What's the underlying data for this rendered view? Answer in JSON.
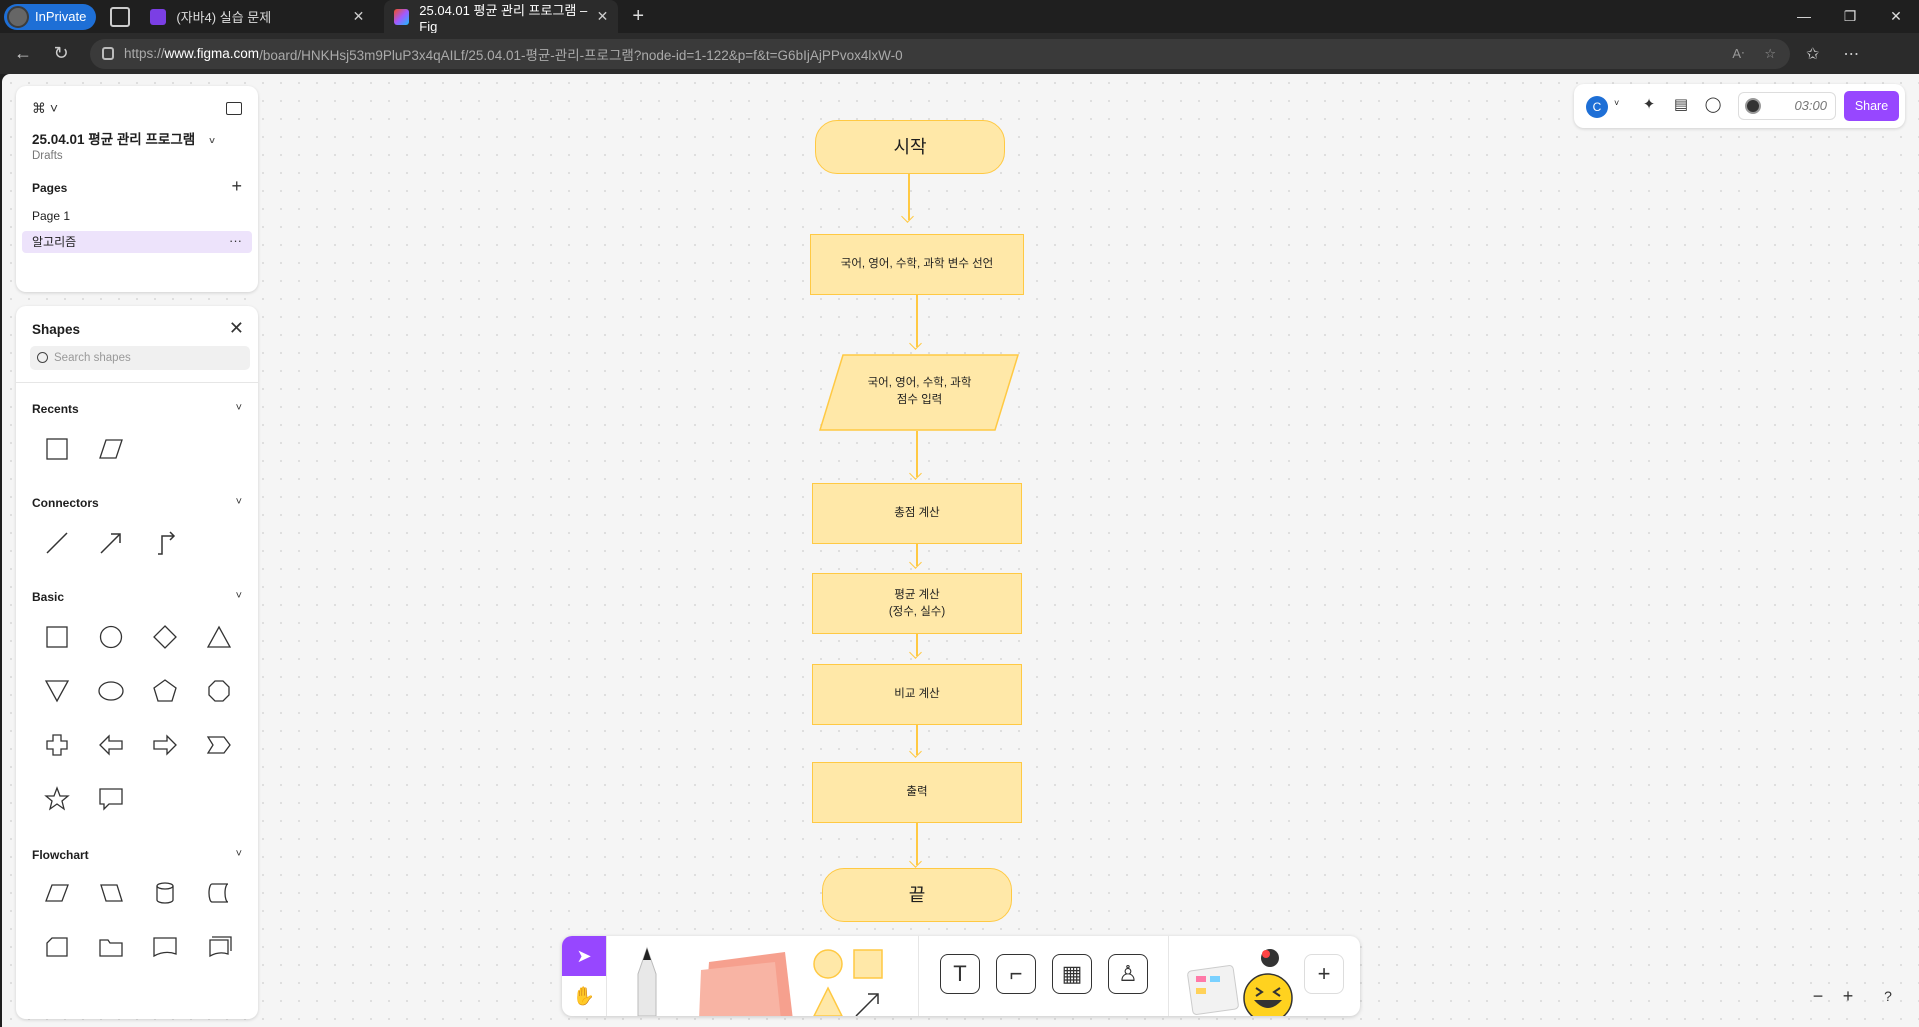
{
  "browser": {
    "inprivate_label": "InPrivate",
    "tabs": [
      {
        "title": "(자바4) 실습 문제"
      },
      {
        "title": "25.04.01 평균 관리 프로그램 – Fig"
      }
    ],
    "url_prefix": "https://",
    "url_domain": "www.figma.com",
    "url_path": "/board/HNKHsj53m9PluP3x4qAILf/25.04.01-평균-관리-프로그램?node-id=1-122&p=f&t=G6bIjAjPPvox4lxW-0"
  },
  "file": {
    "title": "25.04.01 평균 관리 프로그램",
    "location": "Drafts",
    "pages_label": "Pages",
    "pages": [
      {
        "label": "Page 1"
      },
      {
        "label": "알고리즘"
      }
    ]
  },
  "shapes_panel": {
    "title": "Shapes",
    "search_placeholder": "Search shapes",
    "sections": {
      "recents": "Recents",
      "connectors": "Connectors",
      "basic": "Basic",
      "flowchart": "Flowchart"
    }
  },
  "toolbar": {
    "avatar_initial": "C",
    "timer": "03:00",
    "share_label": "Share"
  },
  "flowchart": {
    "start": "시작",
    "declare": "국어, 영어, 수학, 과학 변수 선언",
    "input": "국어, 영어, 수학, 과학\n점수 입력",
    "total": "총점 계산",
    "average": "평균 계산\n(정수, 실수)",
    "compare": "비교 계산",
    "output": "출력",
    "end": "끝"
  },
  "colors": {
    "accent": "#9747ff",
    "shape_fill": "#ffe8a8",
    "shape_stroke": "#ffc943",
    "avatar": "#1e6fd6"
  }
}
